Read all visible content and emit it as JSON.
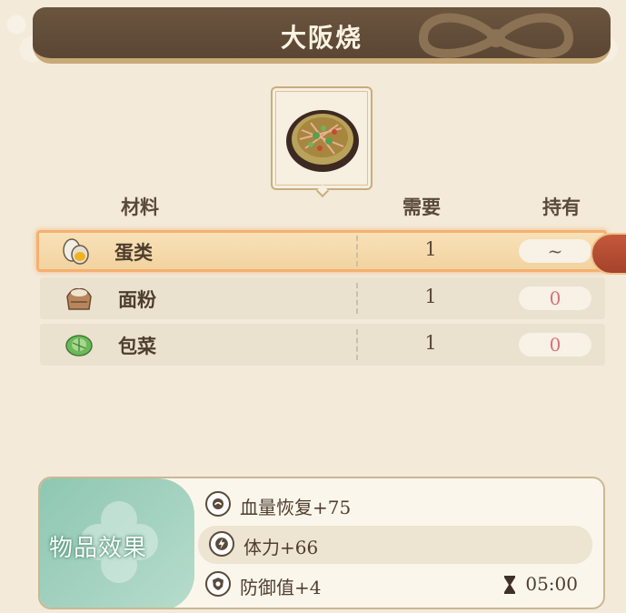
{
  "title": "大阪烧",
  "dish_icon": "okonomiyaki-icon",
  "table": {
    "headers": {
      "material": "材料",
      "need": "需要",
      "have": "持有"
    },
    "rows": [
      {
        "name": "蛋类",
        "need": "1",
        "have": "~",
        "icon": "egg-icon",
        "selected": true
      },
      {
        "name": "面粉",
        "need": "1",
        "have": "0",
        "icon": "flour-sack-icon",
        "selected": false
      },
      {
        "name": "包菜",
        "need": "1",
        "have": "0",
        "icon": "cabbage-icon",
        "selected": false
      }
    ]
  },
  "effects": {
    "title": "物品效果",
    "items": [
      {
        "text": "血量恢复+75",
        "icon": "health-restore-icon"
      },
      {
        "text": "体力+66",
        "icon": "stamina-lightning-icon"
      },
      {
        "text": "防御值+4",
        "icon": "defense-shield-icon"
      }
    ],
    "duration": "05:00"
  },
  "colors": {
    "banner": "#5a4633",
    "selected_border": "#f5b070",
    "zero_value": "#d9707a",
    "effects_green": "#8ec7b2",
    "side_tab": "#b34d33"
  }
}
